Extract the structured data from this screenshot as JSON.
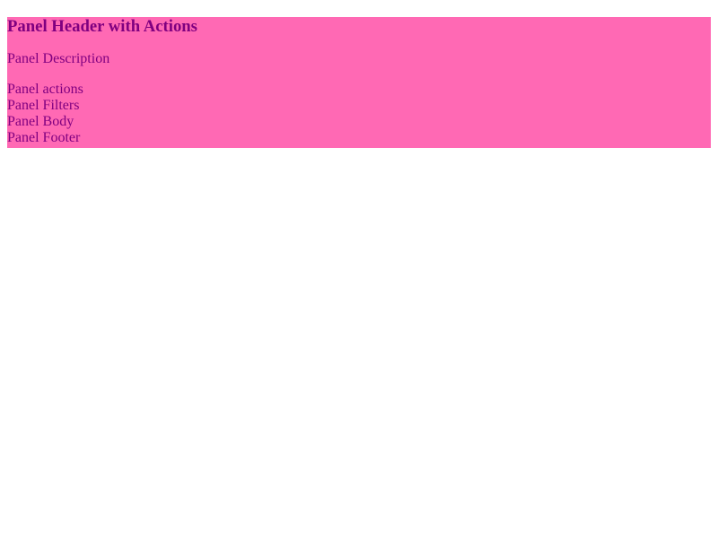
{
  "panel": {
    "title": "Panel Header with Actions",
    "description": "Panel Description",
    "actions_label": "Panel actions",
    "filters_label": "Panel Filters",
    "body_label": "Panel Body",
    "footer_label": "Panel Footer"
  },
  "colors": {
    "panel_background": "#ff69b4",
    "text": "#800080",
    "page_background": "#ffffff"
  }
}
